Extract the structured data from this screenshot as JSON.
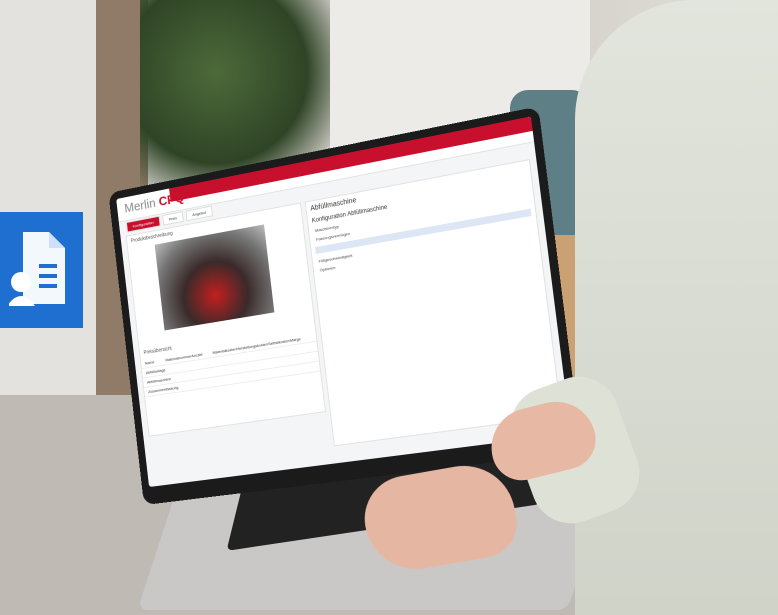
{
  "badge": {
    "icon": "document-user-icon",
    "color": "#1f6fd1"
  },
  "app": {
    "brand_prefix": "Merlin",
    "brand_suffix": "CPQ",
    "accent_color": "#c8102e",
    "tabs": [
      "Konfiguration",
      "Preis",
      "Angebot"
    ],
    "left_section_title": "Produktbeschreibung",
    "price_section_title": "Preisübersicht",
    "table_headers": [
      "Name",
      "Materialnummer",
      "Anzahl",
      "Materialkosten",
      "Herstellungskosten",
      "Selbstkosten",
      "Marge"
    ],
    "table_rows": [
      [
        "Abfüllanlage",
        "",
        "",
        "",
        "",
        "",
        ""
      ],
      [
        "Abfüllmaschine",
        "",
        "",
        "",
        "",
        "",
        ""
      ],
      [
        "Zusammenfassung",
        "",
        "",
        "",
        "",
        "",
        ""
      ]
    ],
    "right_title": "Abfüllmaschine",
    "right_subtitle": "Konfiguration Abfüllmaschine",
    "right_lines": [
      "Maschinentyp",
      "Fassungsvermögen",
      "Füllgeschwindigkeit",
      "Optionen"
    ]
  }
}
